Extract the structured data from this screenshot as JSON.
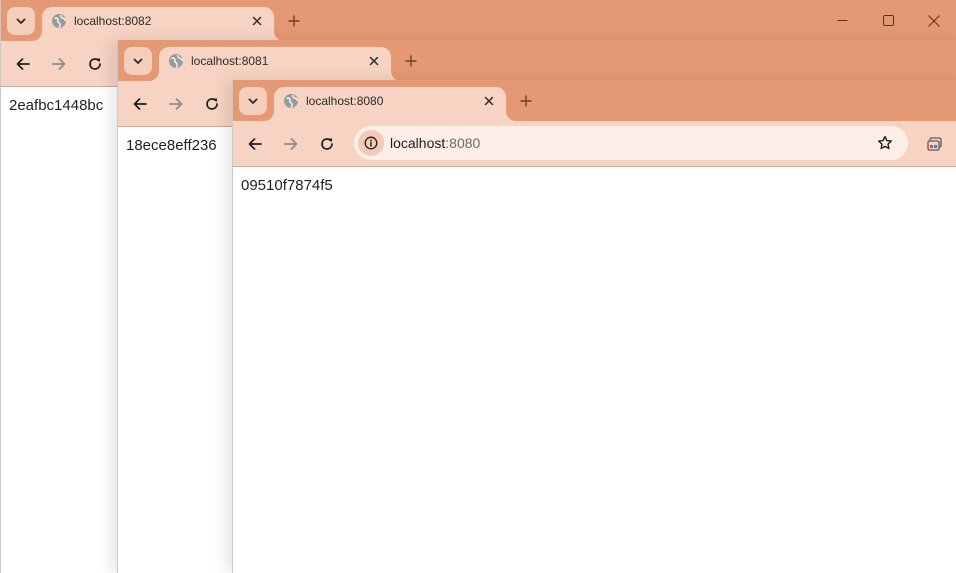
{
  "theme": {
    "titlebar_bg": "#e49873",
    "tab_bg": "#f7d3c3",
    "toolbar_bg": "#f7d3c3",
    "omnibox_bg": "#fdeee7"
  },
  "windows": [
    {
      "id": "back",
      "tab_title": "localhost:8082",
      "content_text": "2eafbc1448bc"
    },
    {
      "id": "middle",
      "tab_title": "localhost:8081",
      "content_text": "18ece8eff236"
    },
    {
      "id": "front",
      "tab_title": "localhost:8080",
      "omnibox_host": "localhost",
      "omnibox_port": ":8080",
      "content_text": "09510f7874f5"
    }
  ],
  "icons": {
    "tab_search": "chevron-down-icon",
    "favicon": "globe-icon",
    "tab_close": "close-icon",
    "new_tab": "plus-icon",
    "back": "arrow-left-icon",
    "forward": "arrow-right-icon",
    "reload": "reload-icon",
    "site_info": "info-icon",
    "bookmark": "star-icon",
    "extra": "tab-groups-icon",
    "minimize": "minimize-icon",
    "maximize": "maximize-icon",
    "close_window": "close-icon"
  }
}
